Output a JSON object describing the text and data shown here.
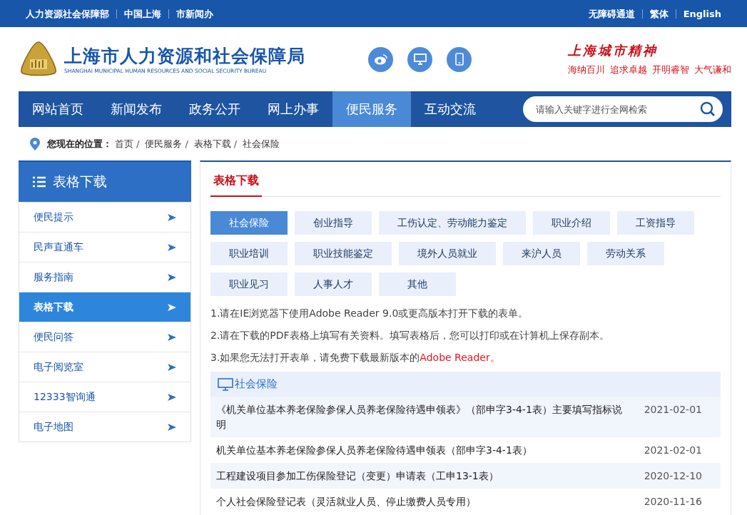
{
  "top_bar": {
    "left_links": [
      "人力资源社会保障部",
      "中国上海",
      "市新闻办"
    ],
    "right_links": [
      "无障碍通道",
      "繁体",
      "English"
    ]
  },
  "header": {
    "title": "上海市人力资源和社会保障局",
    "subtitle": "SHANGHAI MUNICIPAL HUMAN RESOURCES AND SOCIAL SECURITY BUREAU",
    "spirit_title": "上海城市精神",
    "spirit_phrases": [
      "海纳百川",
      "追求卓越",
      "开明睿智",
      "大气谦和"
    ]
  },
  "nav": {
    "items": [
      {
        "label": "网站首页",
        "selected": false
      },
      {
        "label": "新闻发布",
        "selected": false
      },
      {
        "label": "政务公开",
        "selected": false
      },
      {
        "label": "网上办事",
        "selected": false
      },
      {
        "label": "便民服务",
        "selected": true
      },
      {
        "label": "互动交流",
        "selected": false
      }
    ],
    "search": {
      "placeholder": "请输入关键字进行全网检索"
    }
  },
  "breadcrumb": {
    "label": "您现在的位置：",
    "separator": "/",
    "items": [
      "首页",
      "便民服务",
      "表格下载",
      "社会保险"
    ]
  },
  "sidebar": {
    "title": "表格下载",
    "items": [
      {
        "label": "便民提示",
        "selected": false
      },
      {
        "label": "民声直通车",
        "selected": false
      },
      {
        "label": "服务指南",
        "selected": false
      },
      {
        "label": "表格下载",
        "selected": true
      },
      {
        "label": "便民问答",
        "selected": false
      },
      {
        "label": "电子阅览室",
        "selected": false
      },
      {
        "label": "12333智询通",
        "selected": false
      },
      {
        "label": "电子地图",
        "selected": false
      }
    ]
  },
  "content": {
    "title": "表格下载",
    "categories": [
      {
        "label": "社会保险",
        "selected": true
      },
      {
        "label": "创业指导",
        "selected": false
      },
      {
        "label": "工伤认定、劳动能力鉴定",
        "selected": false
      },
      {
        "label": "职业介绍",
        "selected": false
      },
      {
        "label": "工资指导",
        "selected": false
      },
      {
        "label": "职业培训",
        "selected": false
      },
      {
        "label": "职业技能鉴定",
        "selected": false
      },
      {
        "label": "境外人员就业",
        "selected": false
      },
      {
        "label": "来沪人员",
        "selected": false
      },
      {
        "label": "劳动关系",
        "selected": false
      },
      {
        "label": "职业见习",
        "selected": false
      },
      {
        "label": "人事人才",
        "selected": false
      },
      {
        "label": "其他",
        "selected": false
      }
    ],
    "notes": [
      {
        "text": "1.请在IE浏览器下使用Adobe Reader 9.0或更高版本打开下载的表单。"
      },
      {
        "text": "2.请在下载的PDF表格上填写有关资料。填写表格后，您可以打印或在计算机上保存副本。"
      },
      {
        "text": "3.如果您无法打开表单，请免费下载最新版本的",
        "link": "Adobe Reader。"
      }
    ],
    "list_title": "社会保险",
    "rows": [
      {
        "title": "《机关单位基本养老保险参保人员养老保险待遇申领表》（部申字3-4-1表）主要填写指标说明",
        "date": "2021-02-01"
      },
      {
        "title": "机关单位基本养老保险参保人员养老保险待遇申领表（部申字3-4-1表）",
        "date": "2021-02-01"
      },
      {
        "title": "工程建设项目参加工伤保险登记（变更）申请表（工申13-1表）",
        "date": "2020-12-10"
      },
      {
        "title": "个人社会保险登记表（灵活就业人员、停止缴费人员专用）",
        "date": "2020-11-16"
      }
    ]
  }
}
